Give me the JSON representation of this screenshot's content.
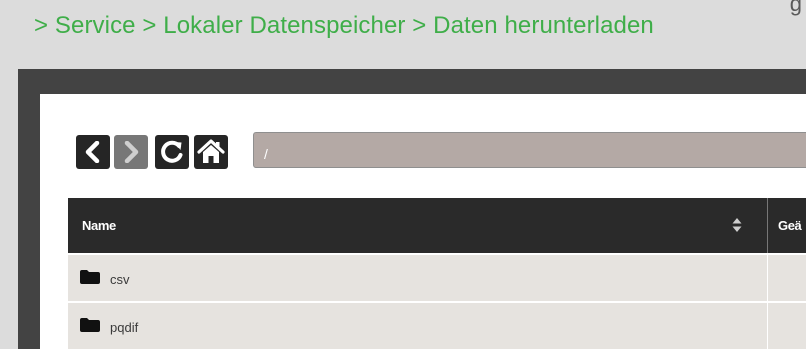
{
  "page": {
    "corner_text": "g",
    "breadcrumb": "> Service > Lokaler Datenspeicher > Daten herunterladen"
  },
  "toolbar": {
    "back_icon": "chevron-left-icon",
    "forward_icon": "chevron-right-icon",
    "refresh_icon": "refresh-icon",
    "home_icon": "home-icon",
    "path_value": "/"
  },
  "table": {
    "columns": [
      "Name",
      "Geä"
    ],
    "rows": [
      {
        "icon": "folder-icon",
        "name": "csv"
      },
      {
        "icon": "folder-icon",
        "name": "pqdif"
      }
    ]
  },
  "colors": {
    "breadcrumb": "#3fae49",
    "frame": "#434343",
    "header": "#2a2a2a",
    "path_field": "#b4a9a5",
    "row": "#e6e3df"
  }
}
